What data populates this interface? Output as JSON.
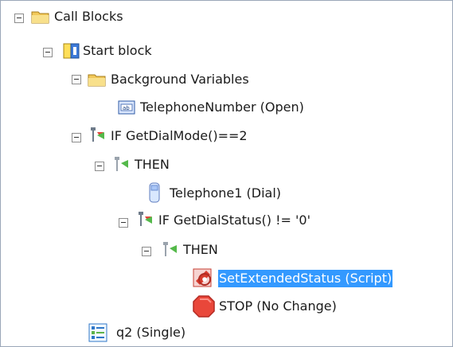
{
  "tree": {
    "nodes": [
      {
        "id": "call_blocks",
        "label": "Call Blocks",
        "icon": "folder-icon",
        "expanded": true
      },
      {
        "id": "start_block",
        "label": "Start block",
        "icon": "start-block-icon",
        "expanded": true
      },
      {
        "id": "background_variables",
        "label": "Background Variables",
        "icon": "folder-icon",
        "expanded": true
      },
      {
        "id": "telephone_number",
        "label": "TelephoneNumber (Open)",
        "icon": "text-field-icon"
      },
      {
        "id": "if_dial_mode",
        "label": "IF GetDialMode()==2",
        "icon": "if-condition-icon",
        "expanded": true
      },
      {
        "id": "then_1",
        "label": "THEN",
        "icon": "then-branch-icon",
        "expanded": true
      },
      {
        "id": "telephone1",
        "label": "Telephone1 (Dial)",
        "icon": "telephone-icon"
      },
      {
        "id": "if_dial_status",
        "label": "IF GetDialStatus() != '0'",
        "icon": "if-condition-icon",
        "expanded": true
      },
      {
        "id": "then_2",
        "label": "THEN",
        "icon": "then-branch-icon",
        "expanded": true
      },
      {
        "id": "set_extended_status",
        "label": "SetExtendedStatus (Script)",
        "icon": "script-icon",
        "selected": true
      },
      {
        "id": "stop_no_change",
        "label": "STOP (No Change)",
        "icon": "stop-icon"
      },
      {
        "id": "q2",
        "label": "q2 (Single)",
        "icon": "list-question-icon"
      }
    ]
  },
  "colors": {
    "selection": "#3399ff",
    "folder": "#f4cf63",
    "stop": "#e9473a",
    "script": "#d83b2d"
  }
}
